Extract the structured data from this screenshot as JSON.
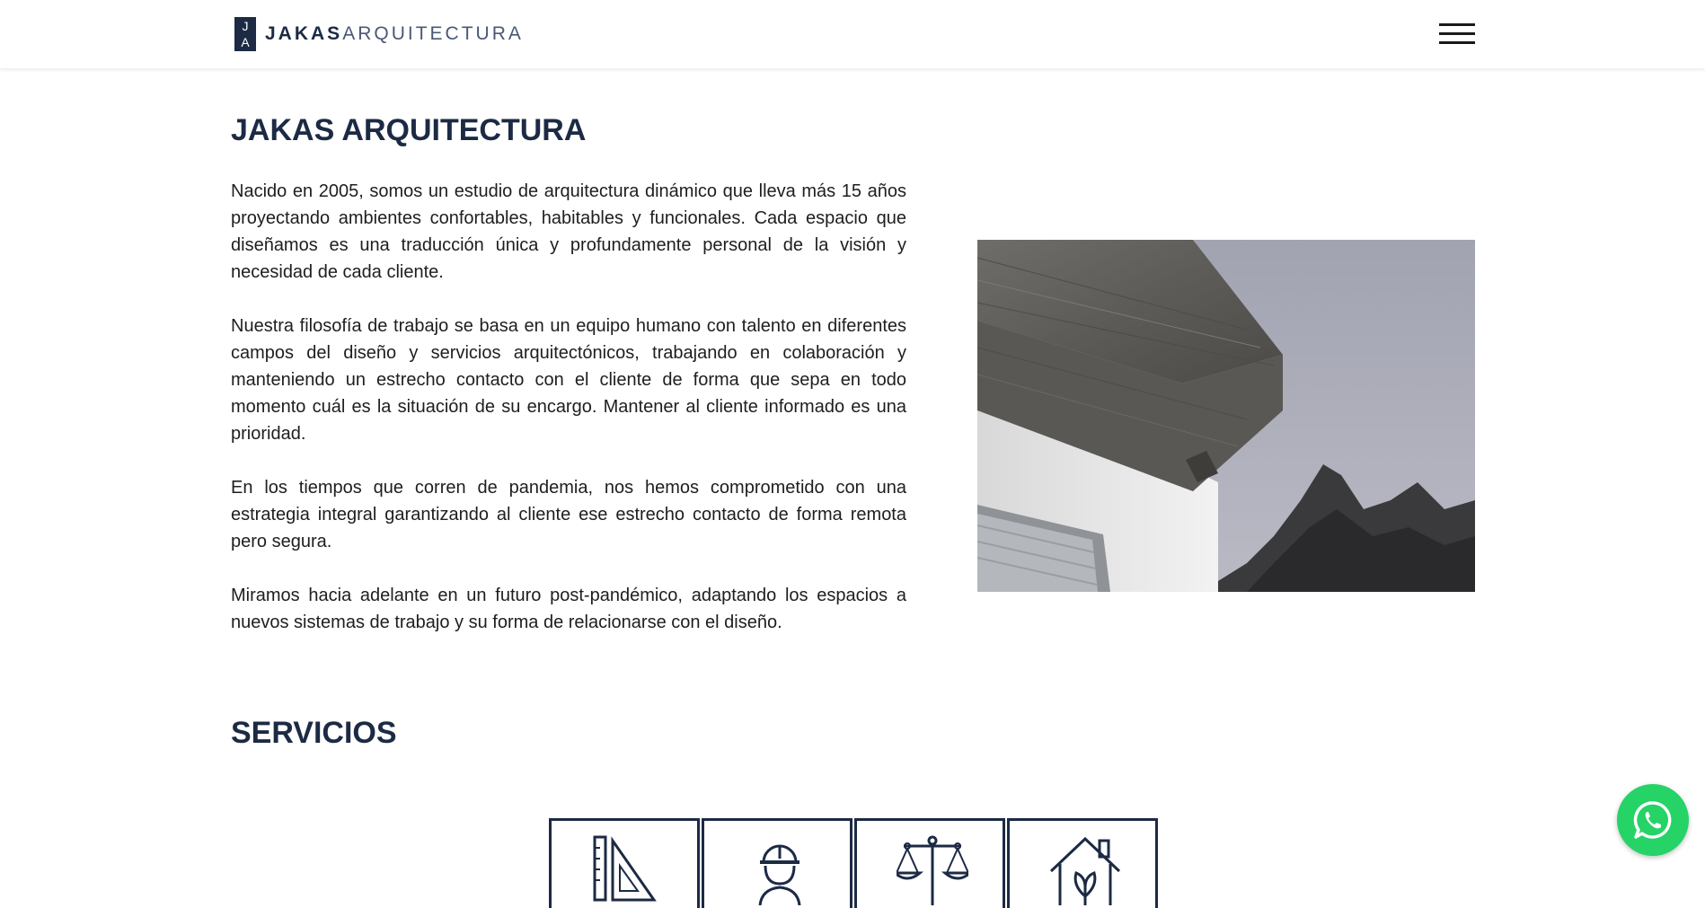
{
  "header": {
    "logo_mark_top": "J",
    "logo_mark_bottom": "A",
    "logo_bold": "JAKAS",
    "logo_light": "ARQUITECTURA"
  },
  "about": {
    "title": "JAKAS ARQUITECTURA",
    "paragraphs": [
      "Nacido en 2005, somos un estudio de arquitectura dinámico que lleva más 15 años proyectando ambientes confortables, habitables y funcionales. Cada espacio que diseñamos es una traducción única y profundamente personal de la visión y necesidad de cada cliente.",
      "Nuestra filosofía de trabajo se basa en un equipo humano con talento en diferentes campos del diseño y servicios arquitectónicos, trabajando en colaboración y manteniendo un estrecho contacto con el cliente de forma que sepa en todo momento cuál es la situación de su encargo. Mantener al cliente informado es una prioridad.",
      "En los tiempos que corren de pandemia, nos hemos comprometido con una estrategia integral garantizando al cliente ese estrecho contacto de forma remota pero segura.",
      "Miramos hacia adelante en un futuro post-pandémico, adaptando los espacios a nuevos sistemas de trabajo y su forma de relacionarse con el diseño."
    ]
  },
  "services": {
    "title": "SERVICIOS",
    "icons": [
      "ruler-triangle-icon",
      "worker-helmet-icon",
      "scale-balance-icon",
      "eco-house-icon"
    ]
  },
  "colors": {
    "brand_navy": "#1c2a44",
    "whatsapp_green": "#25d366"
  }
}
